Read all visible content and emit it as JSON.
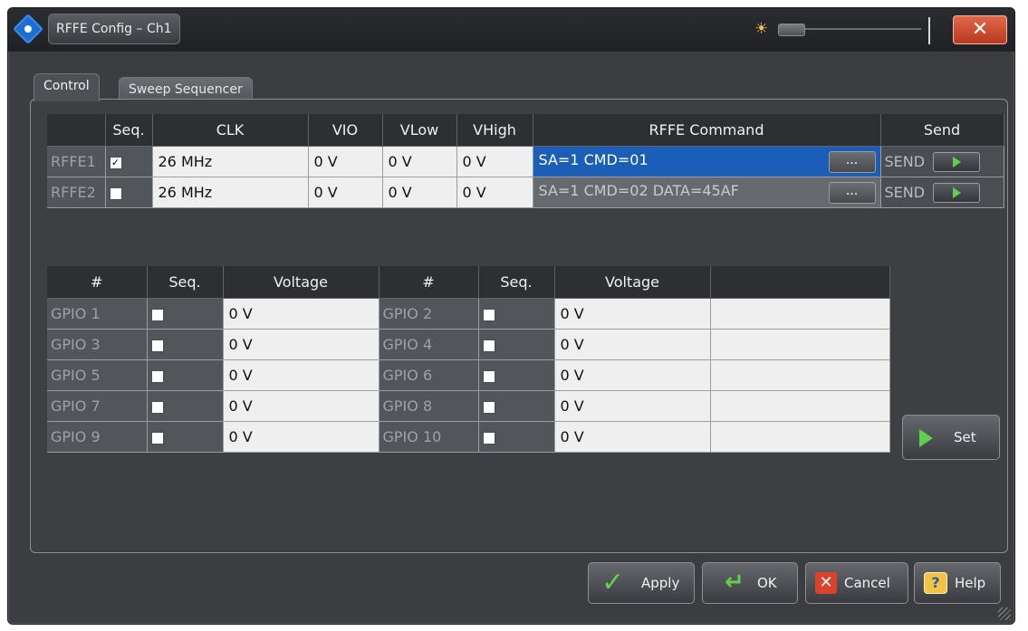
{
  "window": {
    "title": "RFFE Config – Ch1"
  },
  "tabs": [
    {
      "label": "Control",
      "active": true
    },
    {
      "label": "Sweep Sequencer",
      "active": false
    }
  ],
  "rffe": {
    "headers": {
      "seq": "Seq.",
      "clk": "CLK",
      "vio": "VIO",
      "vlow": "VLow",
      "vhigh": "VHigh",
      "command": "RFFE Command",
      "send": "Send"
    },
    "rows": [
      {
        "name": "RFFE1",
        "seq_checked": true,
        "seq_mark": "✓",
        "clk": "26 MHz",
        "vio": "0 V",
        "vlow": "0 V",
        "vhigh": "0 V",
        "command": "SA=1 CMD=01",
        "command_button": "...",
        "send_label": "SEND"
      },
      {
        "name": "RFFE2",
        "seq_checked": false,
        "seq_mark": "",
        "clk": "26 MHz",
        "vio": "0 V",
        "vlow": "0 V",
        "vhigh": "0 V",
        "command": "SA=1 CMD=02 DATA=45AF",
        "command_button": "...",
        "send_label": "SEND"
      }
    ]
  },
  "gpio": {
    "headers": {
      "num": "#",
      "seq": "Seq.",
      "voltage": "Voltage"
    },
    "rows": [
      {
        "left": {
          "name": "GPIO 1",
          "voltage": "0 V"
        },
        "right": {
          "name": "GPIO 2",
          "voltage": "0 V"
        }
      },
      {
        "left": {
          "name": "GPIO 3",
          "voltage": "0 V"
        },
        "right": {
          "name": "GPIO 4",
          "voltage": "0 V"
        }
      },
      {
        "left": {
          "name": "GPIO 5",
          "voltage": "0 V"
        },
        "right": {
          "name": "GPIO 6",
          "voltage": "0 V"
        }
      },
      {
        "left": {
          "name": "GPIO 7",
          "voltage": "0 V"
        },
        "right": {
          "name": "GPIO 8",
          "voltage": "0 V"
        }
      },
      {
        "left": {
          "name": "GPIO 9",
          "voltage": "0 V"
        },
        "right": {
          "name": "GPIO 10",
          "voltage": "0 V"
        }
      }
    ]
  },
  "buttons": {
    "set": "Set",
    "apply": "Apply",
    "ok": "OK",
    "cancel": "Cancel",
    "help": "Help"
  },
  "icons": {
    "app": "rs-logo-icon",
    "brightness": "sun-icon",
    "close": "close-icon"
  },
  "colors": {
    "selection": "#1b5eb8",
    "accent_green": "#5fd04a",
    "close_red": "#c94a2c"
  }
}
